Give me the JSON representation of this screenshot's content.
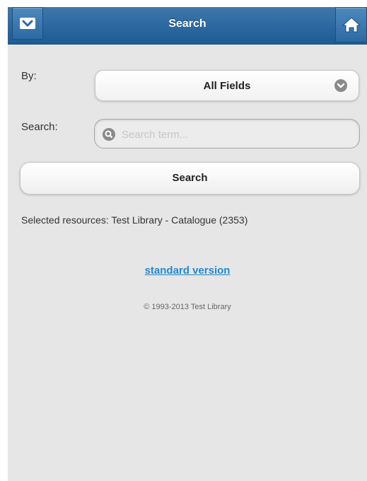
{
  "header": {
    "title": "Search",
    "left_icon": "chevron-down-icon",
    "right_icon": "home-icon",
    "bar_color": "#2a69a2"
  },
  "form": {
    "by_label": "By:",
    "by_selected": "All Fields",
    "search_label": "Search:",
    "search_placeholder": "Search term...",
    "search_value": "",
    "search_button_label": "Search"
  },
  "resources": {
    "text": "Selected resources: Test Library - Catalogue (2353)"
  },
  "footer": {
    "standard_version_link": "standard version",
    "link_color": "#2489ce",
    "copyright": "© 1993-2013 Test Library"
  }
}
